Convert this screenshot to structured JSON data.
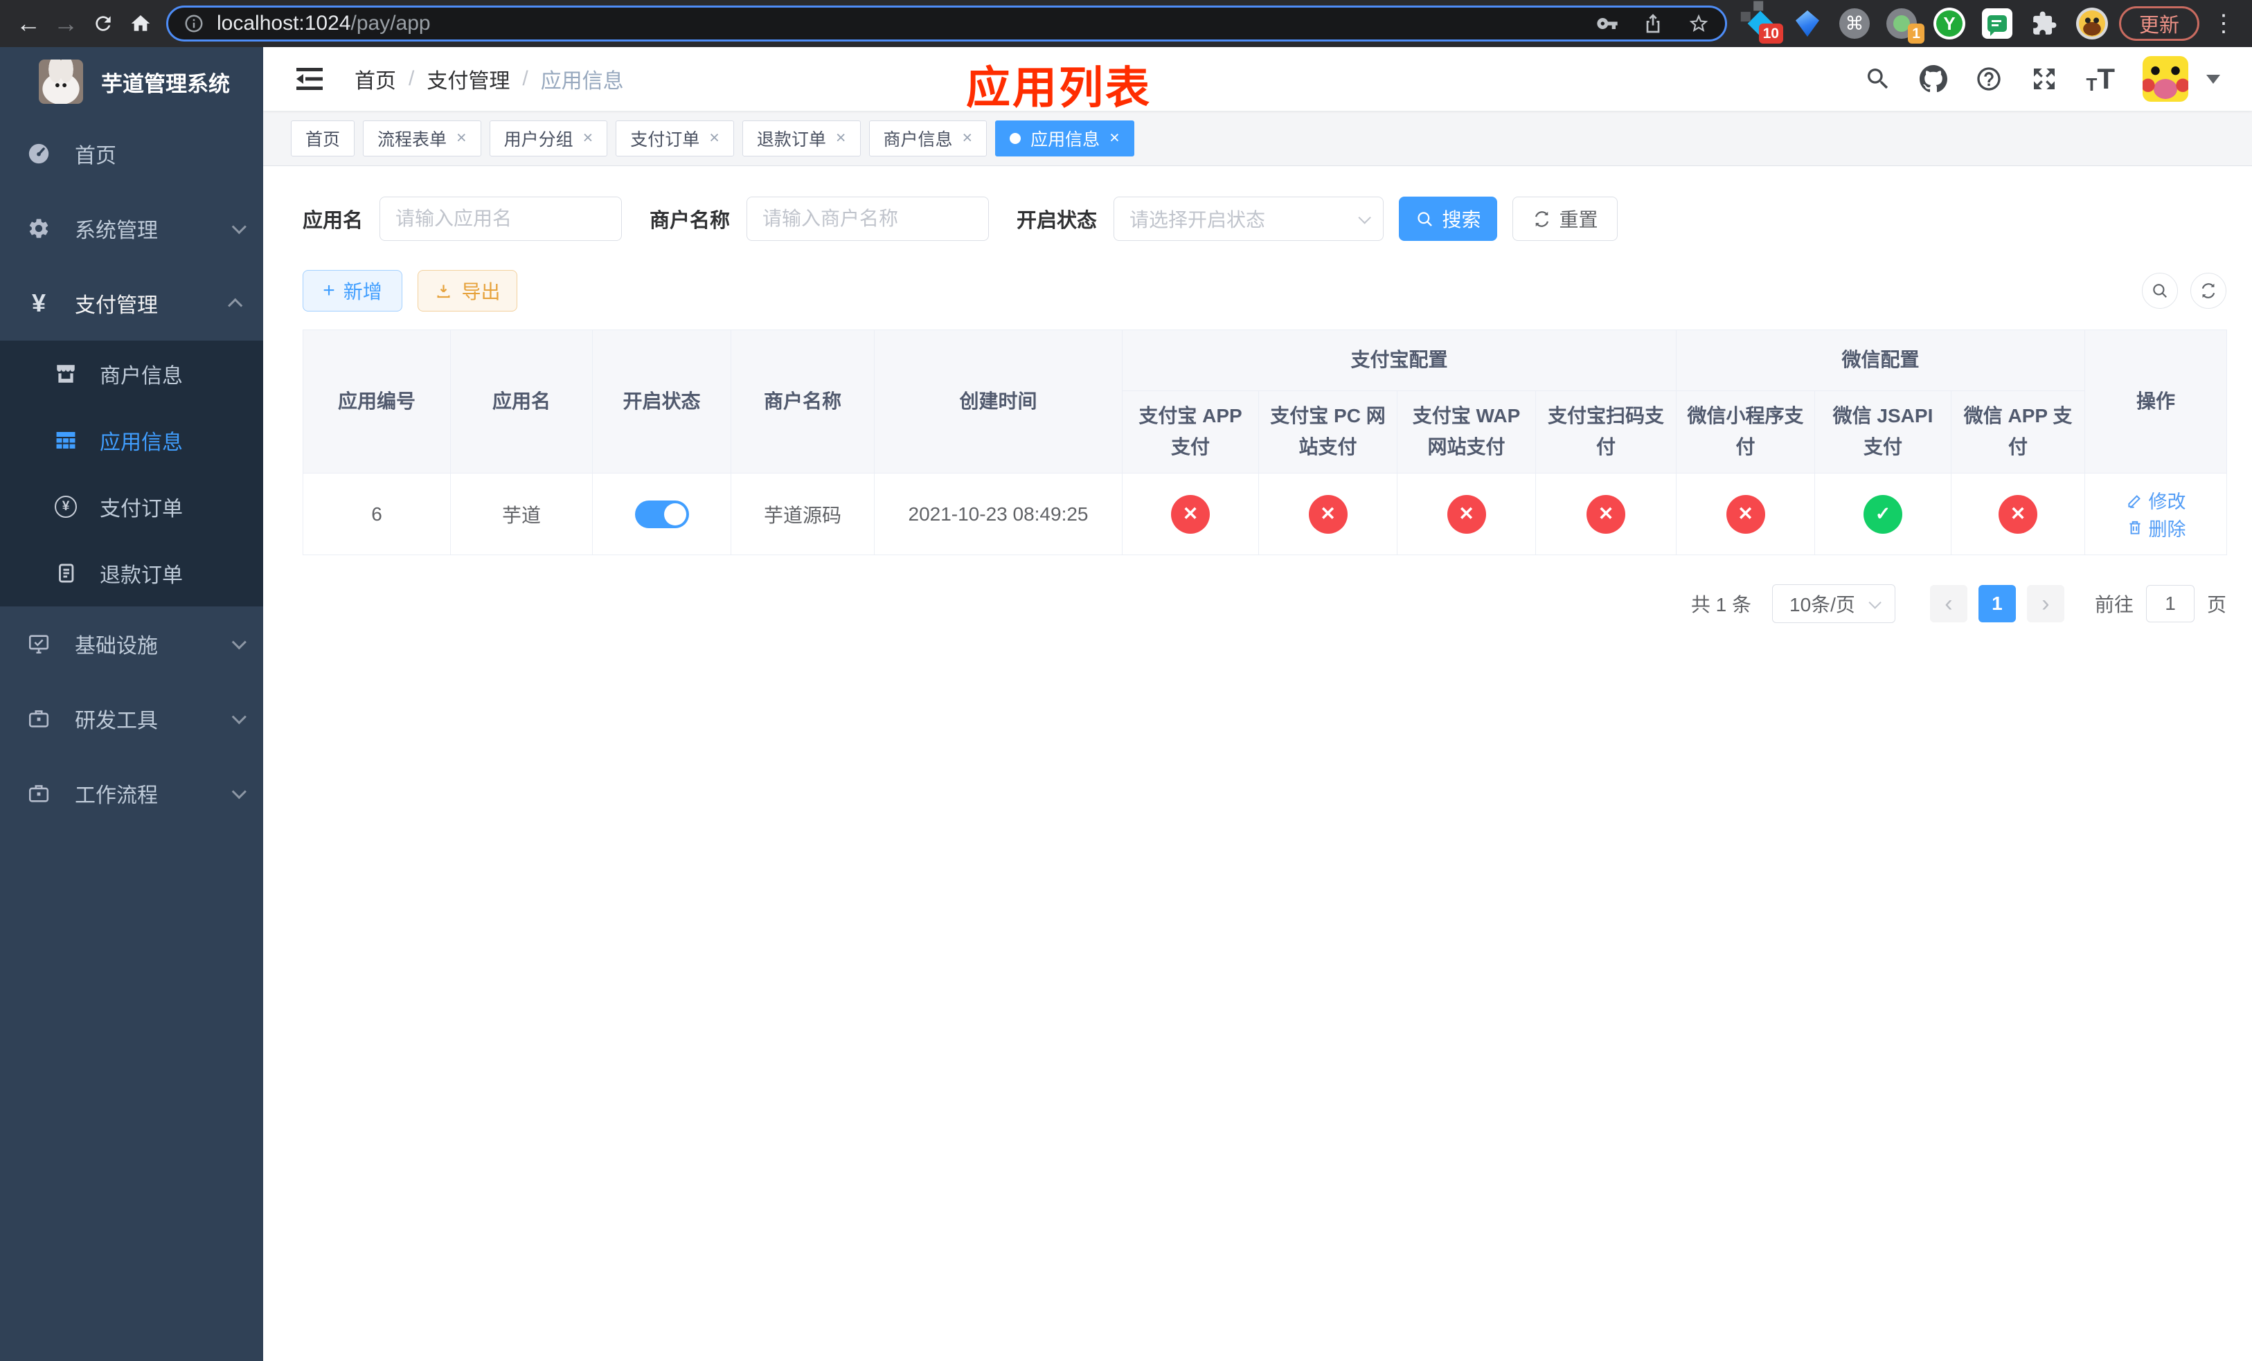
{
  "colors": {
    "accent": "#409eff",
    "success": "#13ce66",
    "danger": "#f6484c",
    "warning": "#e6a23c",
    "sidebar_bg": "#304156",
    "submenu_bg": "#1f2d3d",
    "annotation_red": "#ff2d00"
  },
  "icons": {
    "back": "←",
    "forward": "→",
    "close": "×",
    "check": "✓",
    "cross": "✕",
    "kebab": "⋮",
    "command": "⌘",
    "yen": "¥",
    "y_letter": "Y",
    "plus": "+",
    "t_small": "T",
    "t_large": "T",
    "prev": "‹",
    "next": "›"
  },
  "browser": {
    "url_host": "localhost:1024",
    "url_path": "/pay/app",
    "ext_badge_red": "10",
    "ext_badge_orange": "1",
    "update_label": "更新"
  },
  "sidebar": {
    "title": "芋道管理系统",
    "items": [
      {
        "label": "首页"
      },
      {
        "label": "系统管理"
      },
      {
        "label": "支付管理"
      },
      {
        "label": "基础设施"
      },
      {
        "label": "研发工具"
      },
      {
        "label": "工作流程"
      }
    ],
    "submenu": [
      {
        "label": "商户信息"
      },
      {
        "label": "应用信息"
      },
      {
        "label": "支付订单"
      },
      {
        "label": "退款订单"
      }
    ]
  },
  "header": {
    "breadcrumb": [
      "首页",
      "支付管理",
      "应用信息"
    ],
    "annotation": "应用列表"
  },
  "tabs": [
    {
      "label": "首页"
    },
    {
      "label": "流程表单"
    },
    {
      "label": "用户分组"
    },
    {
      "label": "支付订单"
    },
    {
      "label": "退款订单"
    },
    {
      "label": "商户信息"
    },
    {
      "label": "应用信息"
    }
  ],
  "filters": {
    "app_name_label": "应用名",
    "app_name_placeholder": "请输入应用名",
    "merchant_label": "商户名称",
    "merchant_placeholder": "请输入商户名称",
    "status_label": "开启状态",
    "status_placeholder": "请选择开启状态",
    "search_label": "搜索",
    "reset_label": "重置"
  },
  "toolbar": {
    "add_label": "新增",
    "export_label": "导出"
  },
  "table": {
    "headers": {
      "app_id": "应用编号",
      "app_name": "应用名",
      "status": "开启状态",
      "merchant": "商户名称",
      "created": "创建时间",
      "alipay_group": "支付宝配置",
      "wechat_group": "微信配置",
      "actions": "操作",
      "sub": [
        "支付宝 APP 支付",
        "支付宝 PC 网站支付",
        "支付宝 WAP 网站支付",
        "支付宝扫码支付",
        "微信小程序支付",
        "微信 JSAPI 支付",
        "微信 APP 支付"
      ]
    },
    "row": {
      "app_id": "6",
      "app_name": "芋道",
      "status_on": true,
      "merchant": "芋道源码",
      "created": "2021-10-23 08:49:25",
      "configs": [
        "no",
        "no",
        "no",
        "no",
        "no",
        "yes",
        "no"
      ],
      "edit_label": "修改",
      "delete_label": "删除"
    }
  },
  "pagination": {
    "total": "共 1 条",
    "page_size": "10条/页",
    "current_page": "1",
    "goto_label": "前往",
    "goto_value": "1",
    "page_unit": "页"
  }
}
